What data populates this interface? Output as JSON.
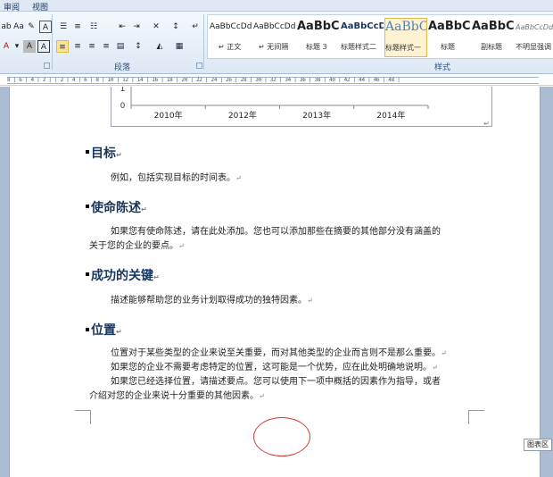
{
  "ribbon": {
    "tabs": [
      "审阅",
      "视图"
    ],
    "groups": {
      "paragraph": "段落",
      "styles": "样式"
    },
    "font_buttons": {
      "font_color": "A",
      "highlight": "A",
      "shading": "A"
    },
    "styles": [
      {
        "sample": "AaBbCcDd",
        "name": "↵ 正文"
      },
      {
        "sample": "AaBbCcDd",
        "name": "↵ 无间隔"
      },
      {
        "sample": "AaBbC",
        "name": "标题 3"
      },
      {
        "sample": "AaBbCcD",
        "name": "标题样式二"
      },
      {
        "sample": "AaBbC",
        "name": "标题样式一"
      },
      {
        "sample": "AaBbC",
        "name": "标题"
      },
      {
        "sample": "AaBbC",
        "name": "副标题"
      },
      {
        "sample": "AaBbCcDd",
        "name": "不明显强调"
      }
    ]
  },
  "ruler": {
    "marks": "8 | 6 | 4 | 2 | | 2 | 4 | 6 | 8 | 10 | 12 | 14 | 16 | 18 | 20 | 22 | 24 | 26 | 28 | 30 | 32 | 34 | 36 | 38 | 40 | 42 | 44 | 46 | 48 |"
  },
  "chart_data": {
    "type": "bar",
    "categories": [
      "2010年",
      "2012年",
      "2013年",
      "2014年"
    ],
    "ytick_labels": [
      "1",
      "0"
    ]
  },
  "document": {
    "sections": [
      {
        "heading": "目标",
        "lines": [
          "例如，包括实现目标的时间表。"
        ]
      },
      {
        "heading": "使命陈述",
        "lines": [
          "如果您有使命陈述，请在此处添加。您也可以添加那些在摘要的其他部分没有涵盖的",
          "关于您的企业的要点。"
        ]
      },
      {
        "heading": "成功的关键",
        "lines": [
          "描述能够帮助您的业务计划取得成功的独特因素。"
        ]
      },
      {
        "heading": "位置",
        "lines": [
          "位置对于某些类型的企业来说至关重要，而对其他类型的企业而言则不是那么重要。",
          "如果您的企业不需要考虑特定的位置，这可能是一个优势，应在此处明确地说明。",
          "如果您已经选择位置，请描述要点。您可以使用下一项中概括的因素作为指导，或者",
          "介绍对您的企业来说十分重要的其他因素。"
        ]
      }
    ],
    "pilcrow": "↵"
  },
  "chart_area_tag": "图表区"
}
